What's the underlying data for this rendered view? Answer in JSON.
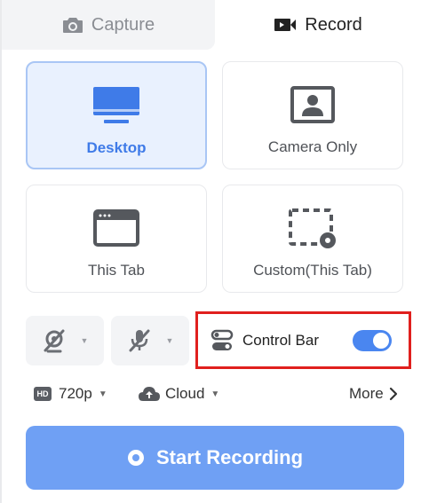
{
  "tabs": [
    {
      "label": "Capture",
      "icon": "camera-icon",
      "active": false
    },
    {
      "label": "Record",
      "icon": "video-camera-icon",
      "active": true
    }
  ],
  "modes": [
    {
      "label": "Desktop",
      "icon": "monitor-icon",
      "selected": true
    },
    {
      "label": "Camera Only",
      "icon": "camera-person-icon",
      "selected": false
    },
    {
      "label": "This Tab",
      "icon": "browser-window-icon",
      "selected": false
    },
    {
      "label": "Custom(This Tab)",
      "icon": "custom-region-icon",
      "selected": false
    }
  ],
  "media": {
    "camera_icon": "camera-off-icon",
    "mic_icon": "microphone-off-icon"
  },
  "control_bar": {
    "label": "Control Bar",
    "icon": "toggles-icon",
    "enabled": true
  },
  "options": {
    "resolution_badge": "HD",
    "resolution": "720p",
    "storage": "Cloud",
    "more": "More"
  },
  "start_button": {
    "label": "Start Recording"
  },
  "colors": {
    "accent": "#4a86f0",
    "selected_bg": "#e9f1fe",
    "start_button": "#6fa0f4",
    "highlight_box": "#e0201e"
  }
}
